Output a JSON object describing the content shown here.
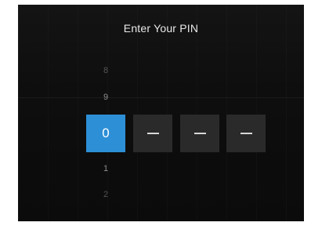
{
  "title": "Enter Your PIN",
  "picker": {
    "above": [
      "8",
      "9"
    ],
    "below": [
      "1",
      "2"
    ]
  },
  "pin": {
    "digits": [
      "0",
      "",
      "",
      ""
    ],
    "active_index": 0
  },
  "colors": {
    "active": "#2d8fd6",
    "inactive": "#2a2a2a",
    "background": "#0e0e0e"
  }
}
